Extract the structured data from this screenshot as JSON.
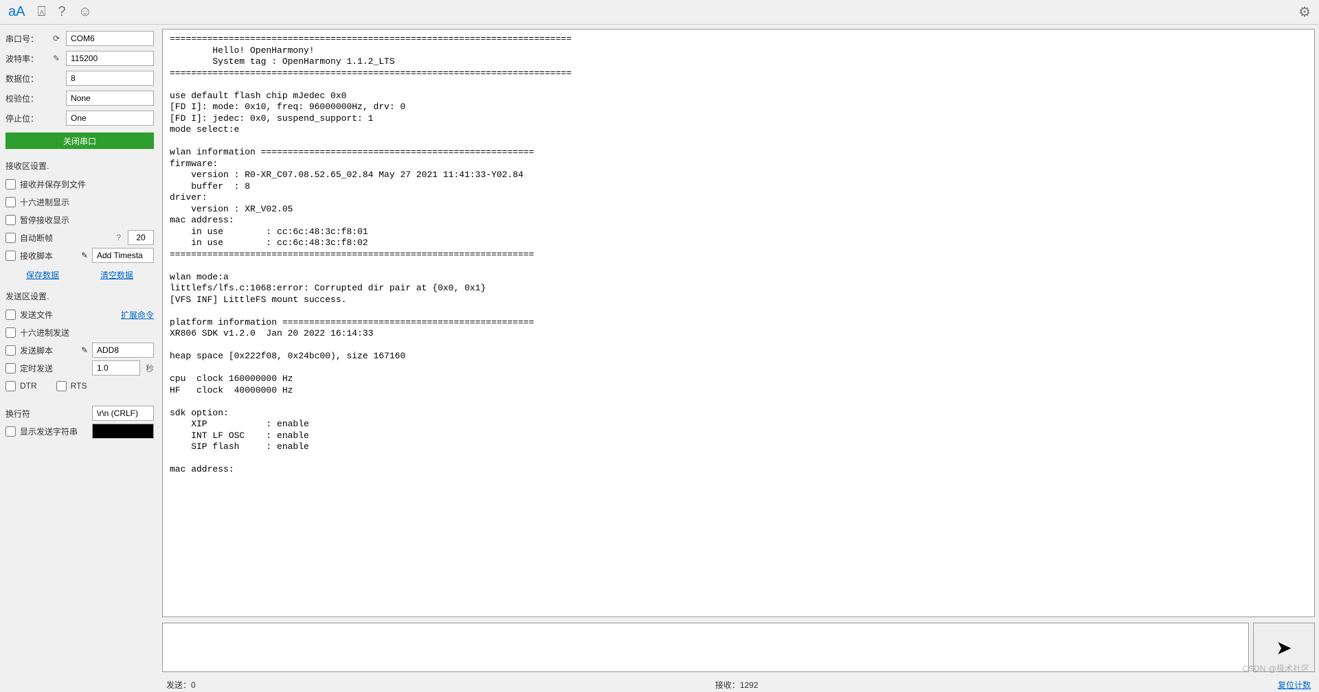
{
  "toolbar": {
    "text_icon": "aA",
    "image_icon": "⍓",
    "help_icon": "?",
    "emoji_icon": "☺",
    "gear_icon": "⚙"
  },
  "config": {
    "port_label": "串口号：",
    "port_value": "COM6",
    "baud_label": "波特率：",
    "baud_value": "115200",
    "databits_label": "数据位：",
    "databits_value": "8",
    "parity_label": "校验位：",
    "parity_value": "None",
    "stopbits_label": "停止位：",
    "stopbits_value": "One",
    "close_btn": "关闭串口"
  },
  "recv": {
    "title": "接收区设置.",
    "save_to_file": "接收并保存到文件",
    "hex_display": "十六进制显示",
    "pause_display": "暂停接收显示",
    "auto_break": "自动断帧",
    "auto_break_help": "?",
    "auto_break_val": "20",
    "recv_script": "接收脚本",
    "script_value": "Add Timesta",
    "save_data": "保存数据",
    "clear_data": "清空数据"
  },
  "send": {
    "title": "发送区设置.",
    "send_file": "发送文件",
    "extend_cmd": "扩展命令",
    "hex_send": "十六进制发送",
    "send_script": "发送脚本",
    "script_value": "ADD8",
    "timed_send": "定时发送",
    "timed_val": "1.0",
    "timed_unit": "秒",
    "dtr": "DTR",
    "rts": "RTS"
  },
  "newline": {
    "label": "换行符",
    "value": "\\r\\n (CRLF)",
    "show_send_str": "显示发送字符串"
  },
  "terminal_text": "===========================================================================\n        Hello! OpenHarmony!\n        System tag : OpenHarmony 1.1.2_LTS\n===========================================================================\n\nuse default flash chip mJedec 0x0\n[FD I]: mode: 0x10, freq: 96000000Hz, drv: 0\n[FD I]: jedec: 0x0, suspend_support: 1\nmode select:e\n\nwlan information ===================================================\nfirmware:\n    version : R0-XR_C07.08.52.65_02.84 May 27 2021 11:41:33-Y02.84\n    buffer  : 8\ndriver:\n    version : XR_V02.05\nmac address:\n    in use        : cc:6c:48:3c:f8:01\n    in use        : cc:6c:48:3c:f8:02\n====================================================================\n\nwlan mode:a\nlittlefs/lfs.c:1068:error: Corrupted dir pair at {0x0, 0x1}\n[VFS INF] LittleFS mount success.\n\nplatform information ===============================================\nXR806 SDK v1.2.0  Jan 20 2022 16:14:33\n\nheap space [0x222f08, 0x24bc00), size 167160\n\ncpu  clock 160000000 Hz\nHF   clock  40000000 Hz\n\nsdk option:\n    XIP           : enable\n    INT LF OSC    : enable\n    SIP flash     : enable\n\nmac address:",
  "send_box": {
    "placeholder": "",
    "send_icon": "➤"
  },
  "status": {
    "send_label": "发送：",
    "send_count": "0",
    "recv_label": "接收：",
    "recv_count": "1292",
    "reset_link": "复位计数"
  },
  "watermark": "CSDN @极术社区"
}
